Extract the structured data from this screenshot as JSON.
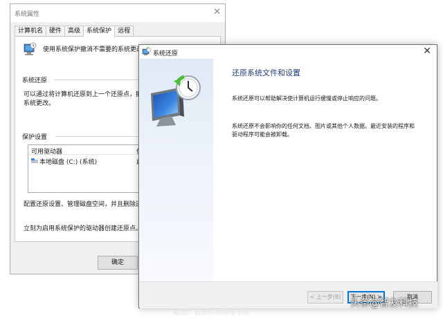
{
  "system_properties": {
    "title": "系统属性",
    "tabs": [
      "计算机名",
      "硬件",
      "高级",
      "系统保护",
      "远程"
    ],
    "active_tab": "系统保护",
    "description": "使用系统保护撤消不需要的系统更改。",
    "restore_section": {
      "heading": "系统还原",
      "text_line1": "可以通过将计算机还原到上一个还原点，撤消",
      "text_line2": "系统更改。"
    },
    "protection_section": {
      "heading": "保护设置",
      "columns": [
        "可用驱动器",
        "保"
      ],
      "rows": [
        {
          "drive": "本地磁盘 (C:) (系统)",
          "status": "启"
        }
      ]
    },
    "configure_text": "配置还原设置、管理磁盘空间，并且删除还原点。",
    "create_text": "立刻为启用系统保护的驱动器创建还原点。",
    "ok_button": "确定"
  },
  "system_restore": {
    "title": "系统还原",
    "heading": "还原系统文件和设置",
    "para1": "系统还原可以帮助解决使计算机运行缓慢或停止响应的问题。",
    "para2_line1": "系统还原不会影响你的任何文档、图片或其他个人数据。最近安装的程序和",
    "para2_line2": "驱动程序可能会被卸载。",
    "buttons": {
      "back": "< 上一步(B)",
      "next": "下一步(N) >",
      "cancel": "取消"
    }
  },
  "watermark": "头条@智友科技",
  "faint_caption": "截图：智友科技网络专用"
}
